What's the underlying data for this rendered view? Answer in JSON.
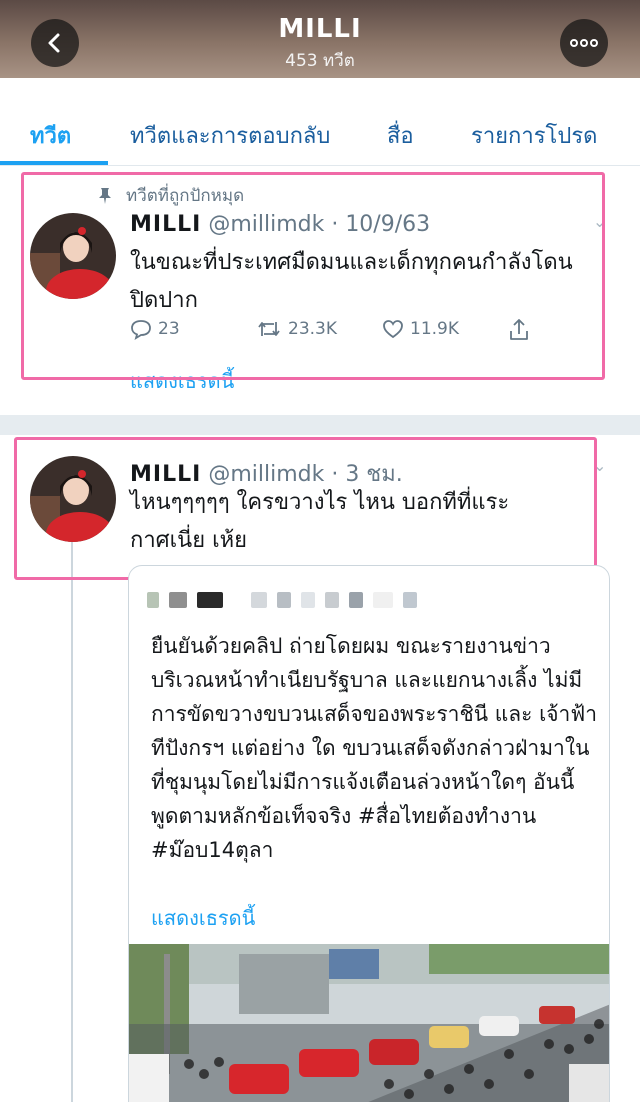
{
  "header": {
    "title": "MILLI",
    "subtitle": "453 ทวีต"
  },
  "tabs": [
    {
      "label": "ทวีต",
      "active": true
    },
    {
      "label": "ทวีตและการตอบกลับ",
      "active": false
    },
    {
      "label": "สื่อ",
      "active": false
    },
    {
      "label": "รายการโปรด",
      "active": false
    }
  ],
  "pinned_tweet": {
    "pin_label": "ทวีตที่ถูกปักหมุด",
    "name": "MILLI",
    "handle": "@millimdk",
    "time": "10/9/63",
    "text": "ในขณะที่ประเทศมืดมนและเด็กทุกคนกำลังโดนปิดปาก",
    "replies": "23",
    "retweets": "23.3K",
    "likes": "11.9K",
    "show_thread": "แสดงเธรดนี้"
  },
  "second_tweet": {
    "name": "MILLI",
    "handle": "@millimdk",
    "time": "3 ชม.",
    "text": "ไหนๆๆๆๆๆ ใครขวางไร ไหน บอกทีที่แระกาศเนี่ย เห้ย"
  },
  "quoted_tweet": {
    "text": "ยืนยันด้วยคลิป ถ่ายโดยผม ขณะรายงานข่าว บริเวณหน้าทำเนียบรัฐบาล และแยกนางเลิ้ง ไม่มีการขัดขวางขบวนเสด็จของพระราชินี และ เจ้าฟ้าทีปังกรฯ แต่อย่าง ใด ขบวนเสด็จดังกล่าวฝ่ามาในที่ชุมนุมโดยไม่มีการแจ้งเตือนล่วงหน้าใดๆ อันนี้พูดตามหลักข้อเท็จจริง #สื่อไทยต้องทำงาน #ม๊อบ14ตุลา",
    "show_thread": "แสดงเธรดนี้"
  },
  "colors": {
    "accent": "#1da1f2",
    "highlight": "#f06aa7",
    "secondary_text": "#657786"
  }
}
